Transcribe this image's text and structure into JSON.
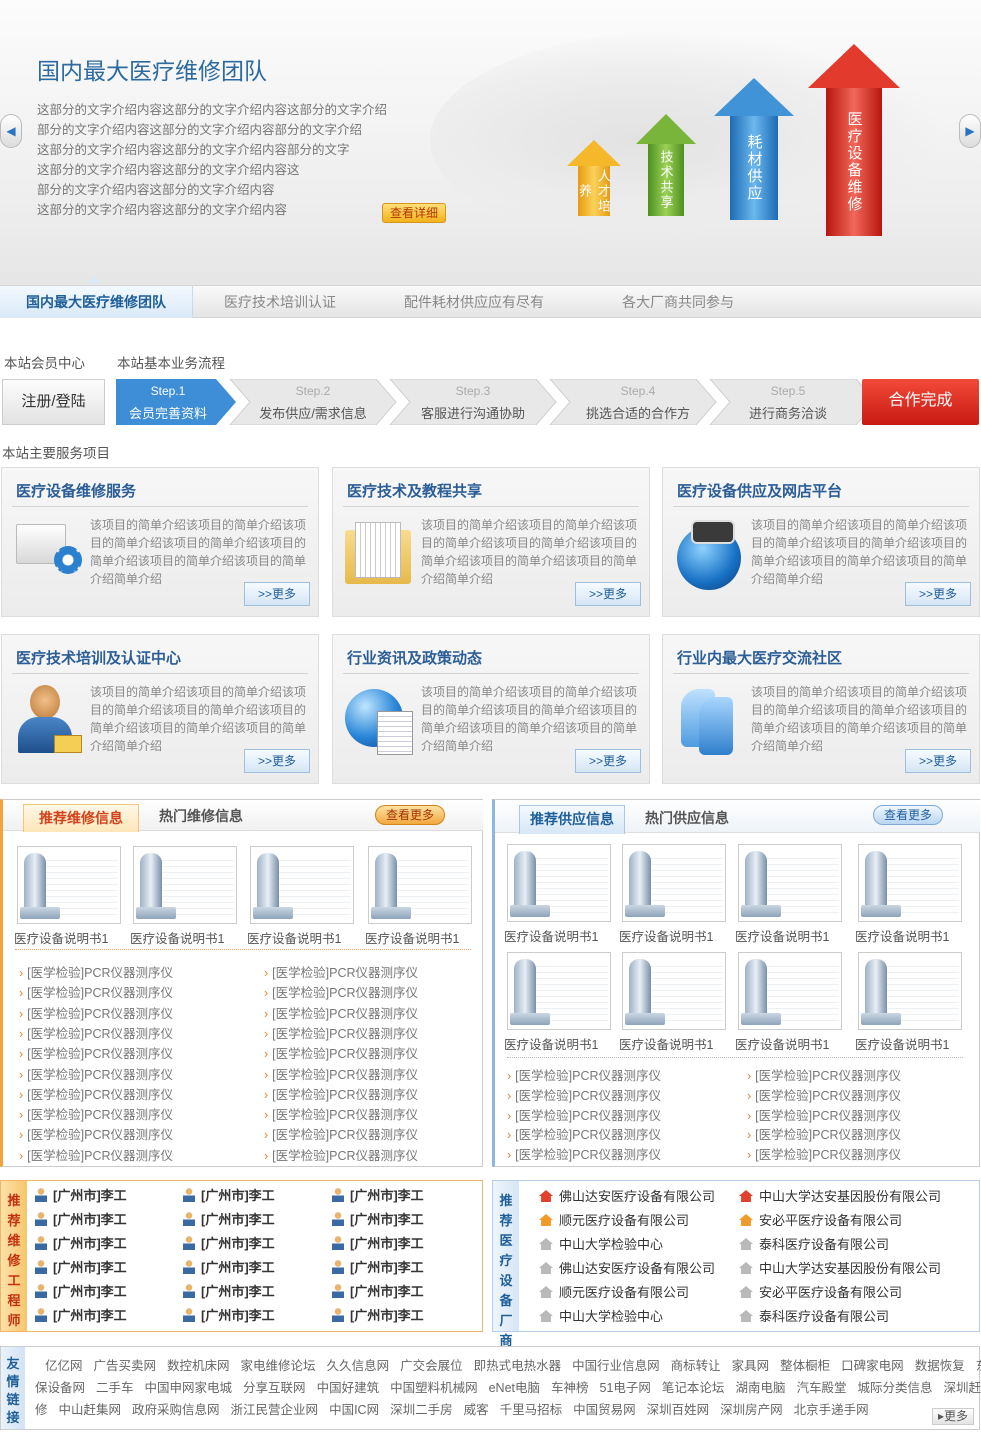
{
  "hero": {
    "title": "国内最大医疗维修团队",
    "desc": [
      "这部分的文字介绍内容这部分的文字介绍内容这部分的文字介绍",
      "部分的文字介绍内容这部分的文字介绍内容部分的文字介绍",
      "这部分的文字介绍内容这部分的文字介绍内容部分的文字",
      "这部分的文字介绍内容这部分的文字介绍内容这",
      "部分的文字介绍内容这部分的文字介绍内容",
      "这部分的文字介绍内容这部分的文字介绍内容"
    ],
    "more": "查看详细",
    "arrows": [
      "人才培养",
      "技术共享",
      "耗材供应",
      "医疗设备维修"
    ],
    "prev": "◀",
    "next": "▶"
  },
  "tabs": [
    "国内最大医疗维修团队",
    "医疗技术培训认证",
    "配件耗材供应应有尽有",
    "各大厂商共同参与"
  ],
  "process": {
    "member_center": "本站会员中心",
    "flow_title": "本站基本业务流程",
    "register": "注册/登陆",
    "steps": [
      {
        "no": "Step.1",
        "text": "会员完善资料"
      },
      {
        "no": "Step.2",
        "text": "发布供应/需求信息"
      },
      {
        "no": "Step.3",
        "text": "客服进行沟通协助"
      },
      {
        "no": "Step.4",
        "text": "挑选合适的合作方"
      },
      {
        "no": "Step.5",
        "text": "进行商务洽谈"
      }
    ],
    "done": "合作完成"
  },
  "services": {
    "title": "本站主要服务项目",
    "desc": "该项目的简单介绍该项目的简单介绍该项目的简单介绍该项目的简单介绍该项目的简单介绍该项目的简单介绍该项目的简单介绍简单介绍",
    "more": ">>更多",
    "items": [
      {
        "title": "医疗设备维修服务",
        "icon": "computer-gear-icon"
      },
      {
        "title": "医疗技术及教程共享",
        "icon": "folder-document-icon"
      },
      {
        "title": "医疗设备供应及网店平台",
        "icon": "equipment-cart-icon"
      },
      {
        "title": "医疗技术培训及认证中心",
        "icon": "person-certificate-icon"
      },
      {
        "title": "行业资讯及政策动态",
        "icon": "globe-news-icon"
      },
      {
        "title": "行业内最大医疗交流社区",
        "icon": "community-heads-icon"
      }
    ]
  },
  "repair": {
    "tab_active": "推荐维修信息",
    "tab_other": "热门维修信息",
    "more": "查看更多",
    "thumb_caption": "医疗设备说明书1",
    "list_item": "[医学检验]PCR仪器测序仪"
  },
  "supply": {
    "tab_active": "推荐供应信息",
    "tab_other": "热门供应信息",
    "more": "查看更多",
    "thumb_caption": "医疗设备说明书1",
    "list_item": "[医学检验]PCR仪器测序仪"
  },
  "engineers": {
    "label": "推荐维修工程师",
    "name": "[广州市]李工"
  },
  "makers": {
    "label": "推荐医疗设备厂商",
    "items": [
      "佛山达安医疗设备有限公司",
      "中山大学达安基因股份有限公司",
      "顺元医疗设备有限公司",
      "安必平医疗设备有限公司",
      "中山大学检验中心",
      "泰科医疗设备有限公司",
      "佛山达安医疗设备有限公司",
      "中山大学达安基因股份有限公司",
      "顺元医疗设备有限公司",
      "安必平医疗设备有限公司",
      "中山大学检验中心",
      "泰科医疗设备有限公司"
    ]
  },
  "links": {
    "label": "友情链接",
    "more": "更多",
    "rows": [
      [
        "亿亿网",
        "广告买卖网",
        "数控机床网",
        "家电维修论坛",
        "久久信息网",
        "广交会展位",
        "即热式电热水器",
        "中国行业信息网",
        "商标转让",
        "家具网",
        "整体橱柜",
        "口碑家电网",
        "数据恢复",
        "东方汽"
      ],
      [
        "保设备网",
        "二手车",
        "中国申网家电城",
        "分享互联网",
        "中国好建筑",
        "中国塑料机械网",
        "eNet电脑",
        "车神榜",
        "51电子网",
        "笔记本论坛",
        "湖南电脑",
        "汽车殿堂",
        "城际分类信息",
        "深圳赶集网"
      ],
      [
        "修",
        "中山赶集网",
        "政府采购信息网",
        "浙江民营企业网",
        "中国IC网",
        "深圳二手房",
        "威客",
        "千里马招标",
        "中国贸易网",
        "深圳百姓网",
        "深圳房产网",
        "北京手递手网"
      ]
    ]
  }
}
